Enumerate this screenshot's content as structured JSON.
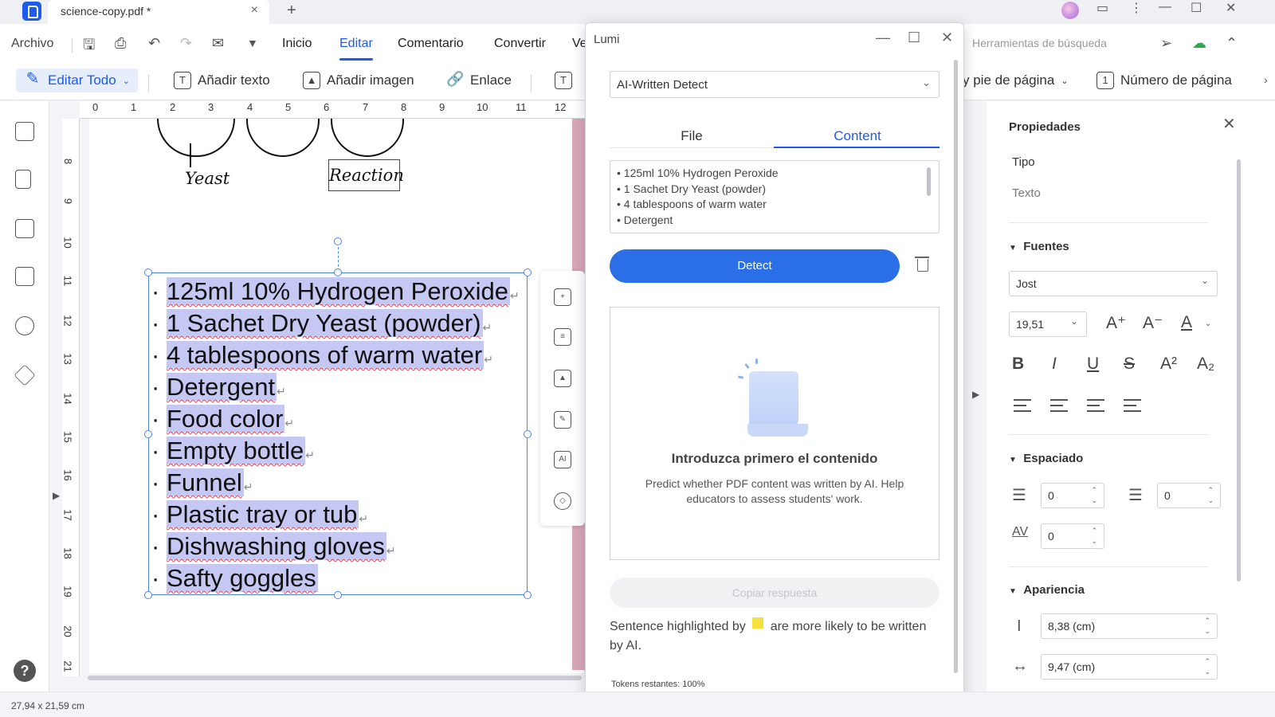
{
  "tab": {
    "title": "science-copy.pdf *"
  },
  "menu": {
    "archivo": "Archivo",
    "items": [
      "Inicio",
      "Editar",
      "Comentario",
      "Convertir",
      "Ve"
    ],
    "search_tools": "Herramientas de búsqueda"
  },
  "toolbar": {
    "edit_all": "Editar Todo",
    "add_text": "Añadir texto",
    "add_image": "Añadir imagen",
    "link": "Enlace",
    "header_footer": "y pie de página",
    "page_number": "Número de página"
  },
  "ruler": {
    "h": [
      "0",
      "1",
      "2",
      "3",
      "4",
      "5",
      "6",
      "7",
      "8",
      "9",
      "10",
      "11",
      "12"
    ],
    "v": [
      "8",
      "9",
      "10",
      "11",
      "12",
      "13",
      "14",
      "15",
      "16",
      "17",
      "18",
      "19",
      "20",
      "21"
    ]
  },
  "drawing": {
    "yeast_label": "Yeast",
    "reaction_label": "Reaction"
  },
  "document": {
    "list": [
      "125ml 10% Hydrogen Peroxide",
      "1 Sachet Dry Yeast (powder)",
      "4 tablespoons of warm water",
      "Detergent",
      "Food color",
      "Empty bottle",
      "Funnel",
      "Plastic tray or tub",
      "Dishwashing gloves",
      "Safty goggles"
    ]
  },
  "lumi": {
    "title": "Lumi",
    "mode": "AI-Written Detect",
    "tabs": [
      "File",
      "Content"
    ],
    "active_tab": "Content",
    "content_lines": [
      "• 125ml 10% Hydrogen Peroxide",
      "• 1 Sachet Dry Yeast (powder)",
      "• 4 tablespoons of warm water",
      "• Detergent"
    ],
    "detect_label": "Detect",
    "empty_title": "Introduzca primero el contenido",
    "empty_desc": "Predict whether PDF content was written by AI. Help educators to assess students' work.",
    "copy_label": "Copiar respuesta",
    "note_before": "Sentence highlighted by",
    "note_after": "are more likely to be written by AI.",
    "highlight_color": "#f6e13a",
    "tokens": "Tokens restantes: 100%"
  },
  "props": {
    "title": "Propiedades",
    "type_label": "Tipo",
    "type_value": "Texto",
    "fonts_section": "Fuentes",
    "font_family": "Jost",
    "font_size": "19,51",
    "spacing_section": "Espaciado",
    "line_spacing": "0",
    "para_spacing": "0",
    "char_spacing": "0",
    "appearance_section": "Apariencia",
    "height": "8,38 (cm)",
    "width": "9,47 (cm)"
  },
  "status": {
    "size": "27,94 x 21,59 cm"
  },
  "colors": {
    "accent": "#1e5bea",
    "detect": "#2a6ee8",
    "selection": "#c5c8f2"
  }
}
